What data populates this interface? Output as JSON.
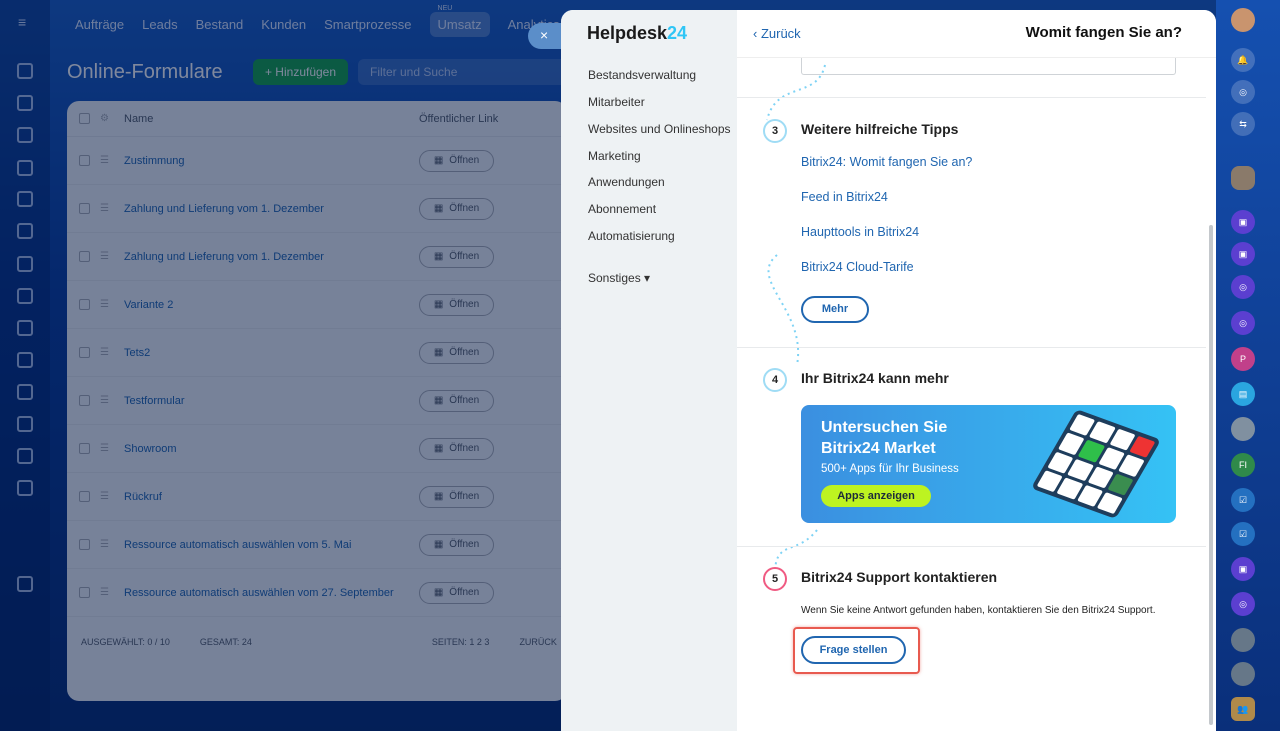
{
  "topnav": {
    "items": [
      "Aufträge",
      "Leads",
      "Bestand",
      "Kunden",
      "Smartprozesse"
    ],
    "active": "Umsatz",
    "active_badge": "NEU",
    "last": "Analytics"
  },
  "page": {
    "title": "Online-Formulare",
    "add_button": "+ Hinzufügen",
    "filter_placeholder": "Filter und Suche"
  },
  "table": {
    "col_name": "Name",
    "col_link": "Öffentlicher Link",
    "open_label": "Öffnen",
    "rows": [
      "Zustimmung",
      "Zahlung und Lieferung vom 1. Dezember",
      "Zahlung und Lieferung vom 1. Dezember",
      "Variante 2",
      "Tets2",
      "Testformular",
      "Showroom",
      "Rückruf",
      "Ressource automatisch auswählen vom 5. Mai",
      "Ressource automatisch auswählen vom 27. September"
    ],
    "footer": {
      "selected": "AUSGEWÄHLT: 0 / 10",
      "total": "GESAMT: 24",
      "pages": "SEITEN: 1 2 3",
      "back": "ZURÜCK"
    }
  },
  "panel": {
    "close": "×",
    "logo_main": "Helpdesk",
    "logo_num": "24",
    "menu": [
      "Bestandsverwaltung",
      "Mitarbeiter",
      "Websites und Onlineshops",
      "Marketing",
      "Anwendungen",
      "Abonnement",
      "Automatisierung"
    ],
    "menu_other": "Sonstiges ▾",
    "back": "Zurück",
    "title": "Womit fangen Sie an?",
    "s3": {
      "num": "3",
      "title": "Weitere hilfreiche Tipps",
      "links": [
        "Bitrix24: Womit fangen Sie an?",
        "Feed in Bitrix24",
        "Haupttools in Bitrix24",
        "Bitrix24 Cloud-Tarife"
      ],
      "more": "Mehr"
    },
    "s4": {
      "num": "4",
      "title": "Ihr Bitrix24 kann mehr",
      "banner_title1": "Untersuchen Sie",
      "banner_title2": "Bitrix24 Market",
      "banner_sub": "500+ Apps für Ihr Business",
      "banner_button": "Apps anzeigen"
    },
    "s5": {
      "num": "5",
      "title": "Bitrix24 Support kontaktieren",
      "desc": "Wenn Sie keine Antwort gefunden haben, kontaktieren Sie den Bitrix24 Support.",
      "button": "Frage stellen"
    }
  },
  "right_sidebar": {
    "p_badge": "P",
    "fi_badge": "FI"
  }
}
